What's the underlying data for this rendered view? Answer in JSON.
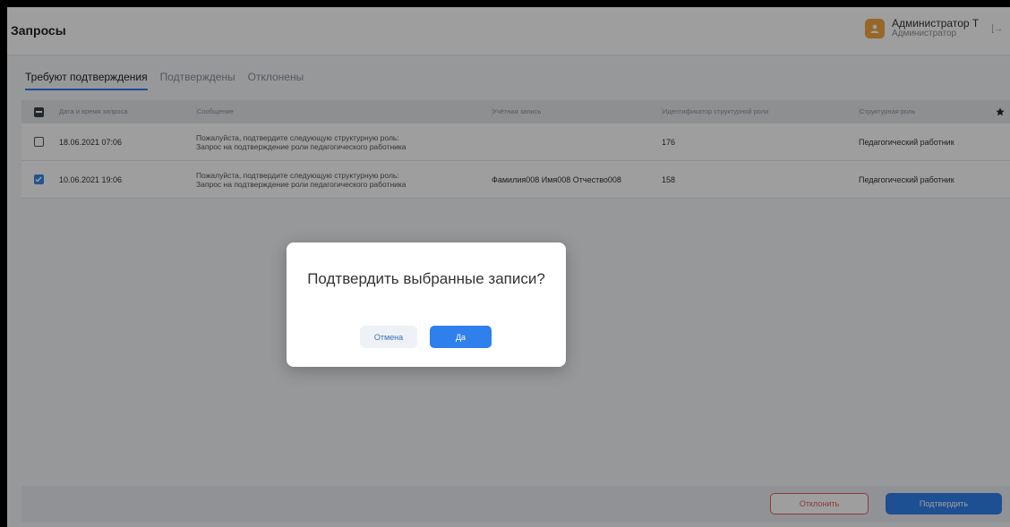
{
  "header": {
    "title": "Запросы",
    "user_name": "Администратор Т",
    "user_role": "Администратор"
  },
  "tabs": [
    {
      "label": "Требуют подтверждения"
    },
    {
      "label": "Подтверждены"
    },
    {
      "label": "Отклонены"
    }
  ],
  "table": {
    "columns": [
      "Дата и время запроса",
      "Сообщение",
      "Учётная запись",
      "Идентификатор структурной роли",
      "Структурная роль"
    ],
    "rows": [
      {
        "date": "18.06.2021 07:06",
        "message_line1": "Пожалуйста, подтвердите следующую структурную роль:",
        "message_line2": "Запрос на подтверждение роли педагогического работника",
        "account": "",
        "role_id": "176",
        "role": "Педагогический работник",
        "checked": false
      },
      {
        "date": "10.06.2021 19:06",
        "message_line1": "Пожалуйста, подтвердите следующую структурную роль:",
        "message_line2": "Запрос на подтверждение роли педагогического работника",
        "account": "Фамилия008 Имя008 Отчество008",
        "role_id": "158",
        "role": "Педагогический работник",
        "checked": true
      }
    ]
  },
  "footer": {
    "reject_label": "Отклонить",
    "confirm_label": "Подтвердить"
  },
  "modal": {
    "title": "Подтвердить выбранные записи?",
    "cancel_label": "Отмена",
    "yes_label": "Да"
  },
  "colors": {
    "accent": "#2f80ed",
    "danger": "#e06060",
    "avatar": "#f2a640"
  },
  "icons": [
    "user-avatar-icon",
    "logout-icon",
    "settings-icon",
    "check-icon"
  ]
}
